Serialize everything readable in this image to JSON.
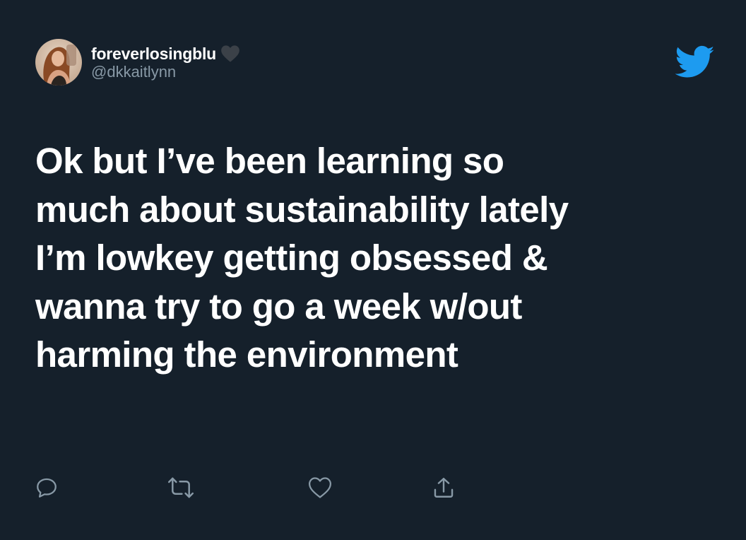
{
  "tweet": {
    "author": {
      "display_name": "foreverlosingblu",
      "handle": "@dkkaitlynn",
      "badge_icon": "heart-icon"
    },
    "text": "Ok but I’ve been learning so\nmuch about sustainability lately\nI’m lowkey getting obsessed &\nwanna try to go a week w/out\nharming the environment",
    "actions": [
      "reply-icon",
      "retweet-icon",
      "like-icon",
      "share-icon"
    ]
  },
  "colors": {
    "background": "#15202b",
    "text_primary": "#ffffff",
    "text_secondary": "#8899a6",
    "twitter_blue": "#1d9bf0"
  }
}
